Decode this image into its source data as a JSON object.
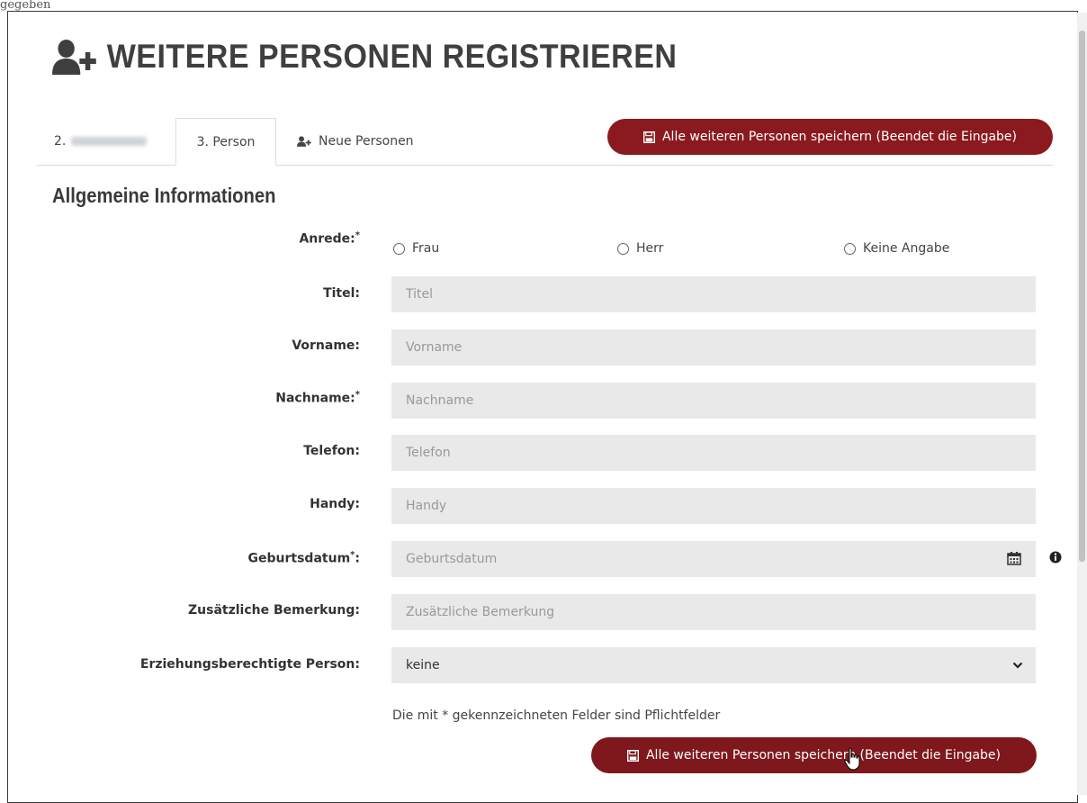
{
  "page": {
    "title": "WEITERE PERSONEN REGISTRIEREN",
    "top_partial_text": "gegeben"
  },
  "tabs": [
    {
      "label": "2.",
      "obscured_name": true
    },
    {
      "label": "3. Person",
      "active": true
    },
    {
      "label": "Neue Personen"
    }
  ],
  "actions": {
    "save_all_label": "Alle weiteren Personen speichern (Beendet die Eingabe)"
  },
  "section": {
    "title": "Allgemeine Informationen"
  },
  "form": {
    "anrede": {
      "label": "Anrede:",
      "required_mark": "*",
      "options": [
        "Frau",
        "Herr",
        "Keine Angabe"
      ]
    },
    "titel": {
      "label": "Titel:",
      "placeholder": "Titel"
    },
    "vorname": {
      "label": "Vorname:",
      "placeholder": "Vorname"
    },
    "nachname": {
      "label": "Nachname:",
      "required_mark": "*",
      "placeholder": "Nachname"
    },
    "telefon": {
      "label": "Telefon:",
      "placeholder": "Telefon"
    },
    "handy": {
      "label": "Handy:",
      "placeholder": "Handy"
    },
    "geburtsdatum": {
      "label": "Geburtsdatum",
      "required_mark": "*",
      "suffix": ":",
      "placeholder": "Geburtsdatum"
    },
    "bemerkung": {
      "label": "Zusätzliche Bemerkung:",
      "placeholder": "Zusätzliche Bemerkung"
    },
    "erziehungsberechtigt": {
      "label": "Erziehungsberechtigte Person:",
      "value": "keine"
    },
    "hint": "Die mit * gekennzeichneten Felder sind Pflichtfelder"
  },
  "colors": {
    "primary_button": "#8b1a1e",
    "field_bg": "#e9e9e9",
    "title_text": "#3f3f3f"
  },
  "icons": [
    "user-plus-icon",
    "save-disk-icon",
    "calendar-icon",
    "info-icon",
    "chevron-down-icon",
    "hand-cursor-icon"
  ]
}
